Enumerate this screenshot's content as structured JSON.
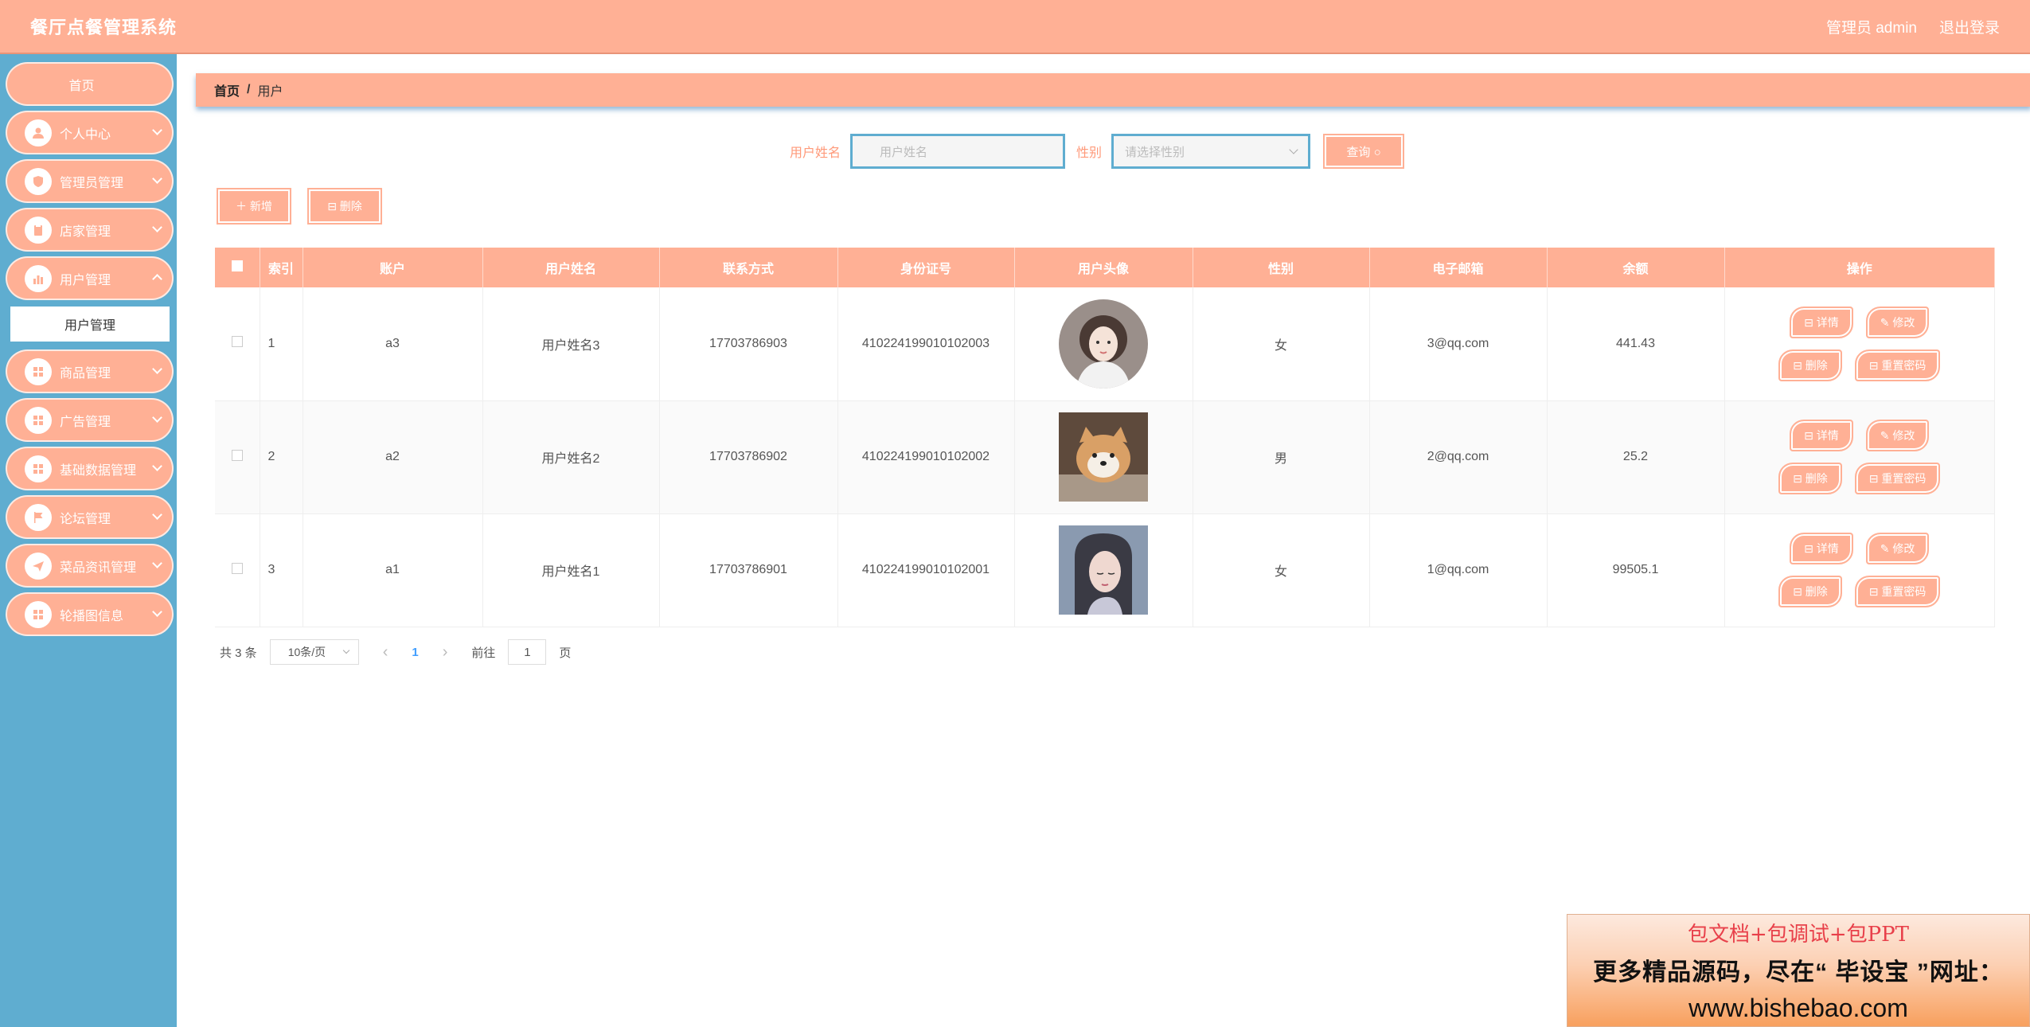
{
  "header": {
    "title": "餐厅点餐管理系统",
    "user_label": "管理员 admin",
    "logout": "退出登录"
  },
  "sidebar": {
    "home": "首页",
    "items": [
      {
        "label": "个人中心",
        "icon": "person-icon"
      },
      {
        "label": "管理员管理",
        "icon": "shield-icon"
      },
      {
        "label": "店家管理",
        "icon": "clipboard-icon"
      },
      {
        "label": "用户管理",
        "icon": "bar-chart-icon"
      },
      {
        "label": "商品管理",
        "icon": "grid-icon"
      },
      {
        "label": "广告管理",
        "icon": "grid-icon"
      },
      {
        "label": "基础数据管理",
        "icon": "grid-icon"
      },
      {
        "label": "论坛管理",
        "icon": "flag-icon"
      },
      {
        "label": "菜品资讯管理",
        "icon": "send-icon"
      },
      {
        "label": "轮播图信息",
        "icon": "grid-icon"
      }
    ],
    "sub_active": "用户管理"
  },
  "breadcrumb": {
    "home": "首页",
    "current": "用户"
  },
  "search": {
    "name_label": "用户姓名",
    "name_placeholder": "用户姓名",
    "gender_label": "性别",
    "gender_placeholder": "请选择性别",
    "query_label": "查询 ○"
  },
  "actions": {
    "add": "＋ 新增",
    "delete": "⊟ 删除"
  },
  "table": {
    "headers": [
      "索引",
      "账户",
      "用户姓名",
      "联系方式",
      "身份证号",
      "用户头像",
      "性别",
      "电子邮箱",
      "余额",
      "操作"
    ],
    "rows": [
      {
        "index": "1",
        "account": "a3",
        "name": "用户姓名3",
        "phone": "17703786903",
        "id_card": "410224199010102003",
        "avatar": "girl-illustration",
        "gender": "女",
        "email": "3@qq.com",
        "balance": "441.43"
      },
      {
        "index": "2",
        "account": "a2",
        "name": "用户姓名2",
        "phone": "17703786902",
        "id_card": "410224199010102002",
        "avatar": "dog-photo",
        "gender": "男",
        "email": "2@qq.com",
        "balance": "25.2"
      },
      {
        "index": "3",
        "account": "a1",
        "name": "用户姓名1",
        "phone": "17703786901",
        "id_card": "410224199010102001",
        "avatar": "girl-photo",
        "gender": "女",
        "email": "1@qq.com",
        "balance": "99505.1"
      }
    ],
    "ops": {
      "detail": "⊟ 详情",
      "edit": "✎ 修改",
      "remove": "⊟ 删除",
      "reset": "⊟ 重置密码"
    }
  },
  "pager": {
    "total": "共 3 条",
    "page_size": "10条/页",
    "current": "1",
    "goto_label": "前往",
    "goto_value": "1",
    "page_suffix": "页"
  },
  "promo": {
    "line1": "包文档+包调试+包PPT",
    "line2": "更多精品源码，尽在“ 毕设宝 ”网址：",
    "line3": "www.bishebao.com"
  },
  "colors": {
    "accent": "#ffb095",
    "sidebar": "#5fadd0"
  }
}
